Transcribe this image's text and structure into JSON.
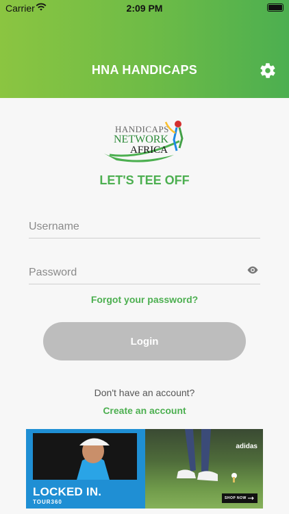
{
  "status_bar": {
    "carrier": "Carrier",
    "time": "2:09 PM"
  },
  "header": {
    "title": "HNA HANDICAPS"
  },
  "logo": {
    "line1": "HANDICAPS",
    "line2": "NETWORK",
    "line3": "AFRICA"
  },
  "tagline": "LET'S TEE OFF",
  "form": {
    "username_placeholder": "Username",
    "password_placeholder": "Password",
    "forgot_label": "Forgot your password?",
    "login_label": "Login"
  },
  "signup": {
    "prompt": "Don't have an account?",
    "create_label": "Create an account"
  },
  "ad": {
    "headline": "LOCKED IN.",
    "brand": "TOUR360",
    "advertiser": "adidas",
    "cta": "SHOP NOW"
  },
  "colors": {
    "accent": "#4caf50",
    "header_start": "#8bc541",
    "header_end": "#4caf50",
    "button_disabled": "#bdbdbd"
  },
  "icons": [
    "wifi-icon",
    "battery-icon",
    "settings-gear-icon",
    "eye-icon",
    "arrow-right-icon"
  ]
}
